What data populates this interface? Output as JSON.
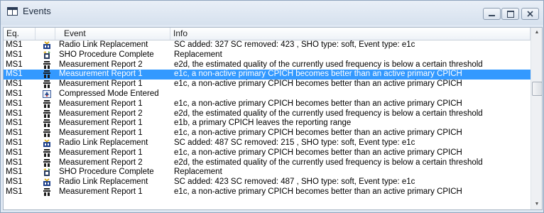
{
  "window": {
    "title": "Events"
  },
  "columns": {
    "eq": "Eq.",
    "event": "Event",
    "info": "Info"
  },
  "rows": [
    {
      "eq": "MS1",
      "icon": "radio-link-icon",
      "event": "Radio Link Replacement",
      "info": "SC added: 327 SC removed: 423 , SHO type: soft, Event type: e1c"
    },
    {
      "eq": "MS1",
      "icon": "sho-icon",
      "event": "SHO Procedure Complete",
      "info": "Replacement"
    },
    {
      "eq": "MS1",
      "icon": "measurement-icon",
      "event": "Measurement Report 2",
      "info": "e2d, the estimated quality of the currently used frequency is below a certain threshold"
    },
    {
      "eq": "MS1",
      "icon": "measurement-icon",
      "event": "Measurement Report 1",
      "info": "e1c, a non-active primary CPICH becomes better than an active primary CPICH",
      "selected": true
    },
    {
      "eq": "MS1",
      "icon": "measurement-icon",
      "event": "Measurement Report 1",
      "info": "e1c, a non-active primary CPICH becomes better than an active primary CPICH"
    },
    {
      "eq": "MS1",
      "icon": "compressed-mode-icon",
      "event": "Compressed Mode Entered",
      "info": ""
    },
    {
      "eq": "MS1",
      "icon": "measurement-icon",
      "event": "Measurement Report 1",
      "info": "e1c, a non-active primary CPICH becomes better than an active primary CPICH"
    },
    {
      "eq": "MS1",
      "icon": "measurement-icon",
      "event": "Measurement Report 2",
      "info": "e2d, the estimated quality of the currently used frequency is below a certain threshold"
    },
    {
      "eq": "MS1",
      "icon": "measurement-icon",
      "event": "Measurement Report 1",
      "info": "e1b, a primary CPICH leaves the reporting range"
    },
    {
      "eq": "MS1",
      "icon": "measurement-icon",
      "event": "Measurement Report 1",
      "info": "e1c, a non-active primary CPICH becomes better than an active primary CPICH"
    },
    {
      "eq": "MS1",
      "icon": "radio-link-icon",
      "event": "Radio Link Replacement",
      "info": "SC added: 487 SC removed: 215 , SHO type: soft, Event type: e1c"
    },
    {
      "eq": "MS1",
      "icon": "measurement-icon",
      "event": "Measurement Report 1",
      "info": "e1c, a non-active primary CPICH becomes better than an active primary CPICH"
    },
    {
      "eq": "MS1",
      "icon": "measurement-icon",
      "event": "Measurement Report 2",
      "info": "e2d, the estimated quality of the currently used frequency is below a certain threshold"
    },
    {
      "eq": "MS1",
      "icon": "sho-icon",
      "event": "SHO Procedure Complete",
      "info": "Replacement"
    },
    {
      "eq": "MS1",
      "icon": "radio-link-icon",
      "event": "Radio Link Replacement",
      "info": "SC added: 423 SC removed: 487 , SHO type: soft, Event type: e1c"
    },
    {
      "eq": "MS1",
      "icon": "measurement-icon",
      "event": "Measurement Report 1",
      "info": "e1c, a non-active primary CPICH becomes better than an active primary CPICH"
    }
  ],
  "colors": {
    "selection": "#3399ff",
    "window_border": "#8fa4bd"
  }
}
